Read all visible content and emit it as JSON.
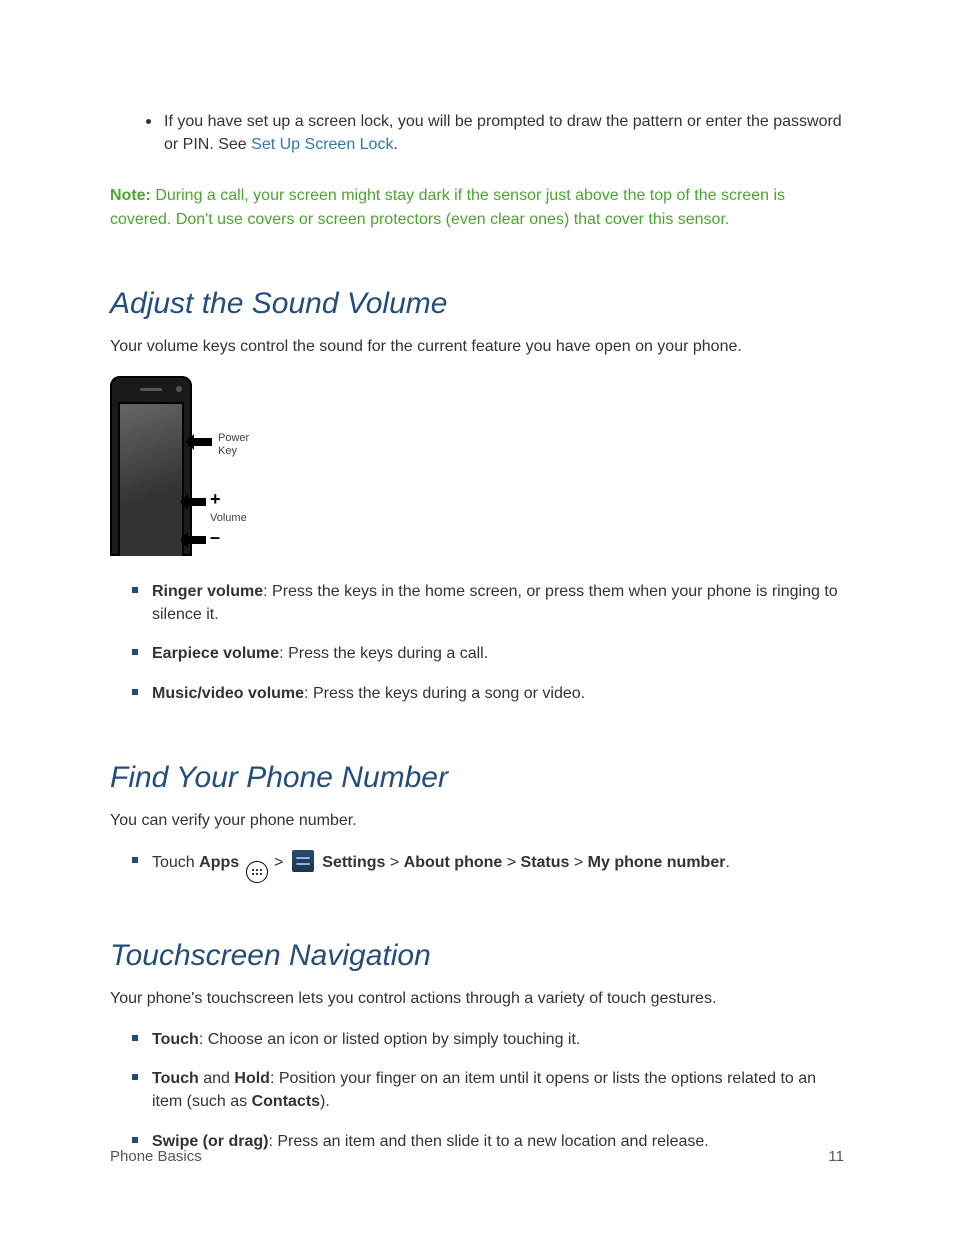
{
  "intro": {
    "bullet_prefix": "If you have set up a screen lock, you will be prompted to draw the pattern or enter the password or PIN. See ",
    "bullet_link": "Set Up Screen Lock",
    "bullet_suffix": "."
  },
  "note": {
    "label": "Note:",
    "text": "During a call, your screen might stay dark if the sensor just above the top of the screen is covered. Don't use covers or screen protectors (even clear ones) that cover this sensor."
  },
  "volume": {
    "heading": "Adjust the Sound Volume",
    "intro": "Your volume keys control the sound for the current feature you have open on your phone.",
    "diagram": {
      "power_label": "Power Key",
      "volume_label": "Volume"
    },
    "items": [
      {
        "term": "Ringer volume",
        "text": ": Press the keys in the home screen, or press them when your phone is ringing to silence it."
      },
      {
        "term": "Earpiece volume",
        "text": ": Press the keys during a call."
      },
      {
        "term": "Music/video volume",
        "text": ": Press the keys during a song or video."
      }
    ]
  },
  "findnumber": {
    "heading": "Find Your Phone Number",
    "intro": "You can verify your phone number.",
    "step": {
      "touch": "Touch ",
      "apps": "Apps",
      "sep": " > ",
      "settings": "Settings",
      "about": "About phone",
      "status": "Status",
      "mynumber": "My phone number",
      "period": "."
    }
  },
  "touchnav": {
    "heading": "Touchscreen Navigation",
    "intro": "Your phone's touchscreen lets you control actions through a variety of touch gestures.",
    "items": {
      "touch": {
        "term": "Touch",
        "text": ": Choose an icon or listed option by simply touching it."
      },
      "hold": {
        "term1": "Touch",
        "mid1": " and ",
        "term2": "Hold",
        "text1": ": Position your finger on an item until it opens or lists the options related to an item (such as ",
        "term3": "Contacts",
        "text2": ")."
      },
      "swipe": {
        "term": "Swipe (or drag)",
        "text": ": Press an item and then slide it to a new location and release."
      }
    }
  },
  "footer": {
    "section": "Phone Basics",
    "page": "11"
  }
}
